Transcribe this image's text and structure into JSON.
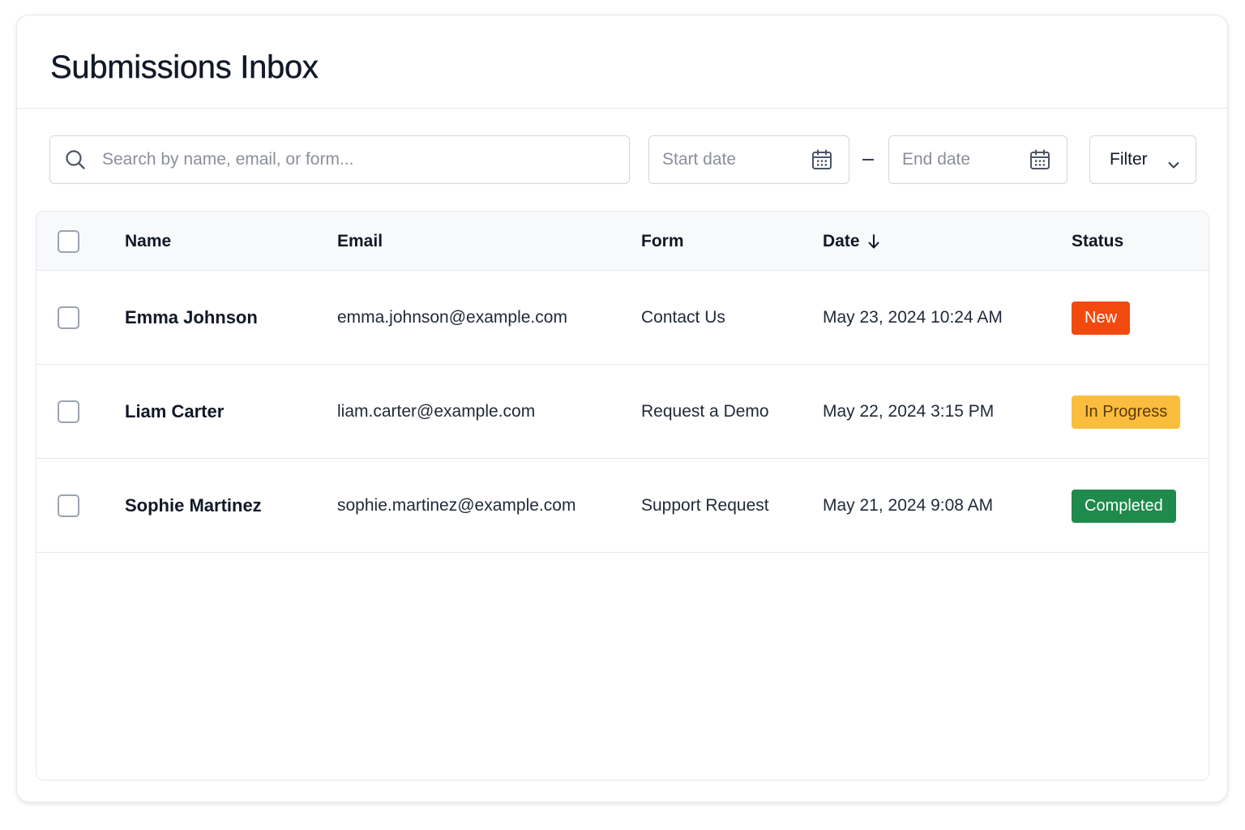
{
  "header": {
    "title": "Submissions Inbox"
  },
  "toolbar": {
    "search_placeholder": "Search by name, email, or form...",
    "start_date_placeholder": "Start date",
    "end_date_placeholder": "End date",
    "filter_label": "Filter"
  },
  "table": {
    "columns": {
      "name": "Name",
      "email": "Email",
      "form": "Form",
      "date": "Date",
      "status": "Status"
    },
    "sort": {
      "column": "date",
      "direction": "descending",
      "icon": "arrow-down-icon"
    },
    "rows": [
      {
        "name": "Emma Johnson",
        "email": "emma.johnson@example.com",
        "form": "Contact Us",
        "date": "May 23, 2024 10:24 AM",
        "status": "New",
        "status_bg": "#f04a0f",
        "status_fg": "#ffffff"
      },
      {
        "name": "Liam Carter",
        "email": "liam.carter@example.com",
        "form": "Request a Demo",
        "date": "May 22, 2024 3:15 PM",
        "status": "In Progress",
        "status_bg": "#fbbd3d",
        "status_fg": "#5b3a08"
      },
      {
        "name": "Sophie Martinez",
        "email": "sophie.martinez@example.com",
        "form": "Support Request",
        "date": "May 21, 2024 9:08 AM",
        "status": "Completed",
        "status_bg": "#1e8a4c",
        "status_fg": "#ffffff"
      }
    ]
  },
  "icons": {
    "search": "search-icon",
    "calendar": "calendar-icon",
    "chevron": "chevron-down-icon"
  },
  "colors": {
    "border": "#e5e7eb",
    "header_bg": "#f8f9fa",
    "text": "#111827"
  }
}
